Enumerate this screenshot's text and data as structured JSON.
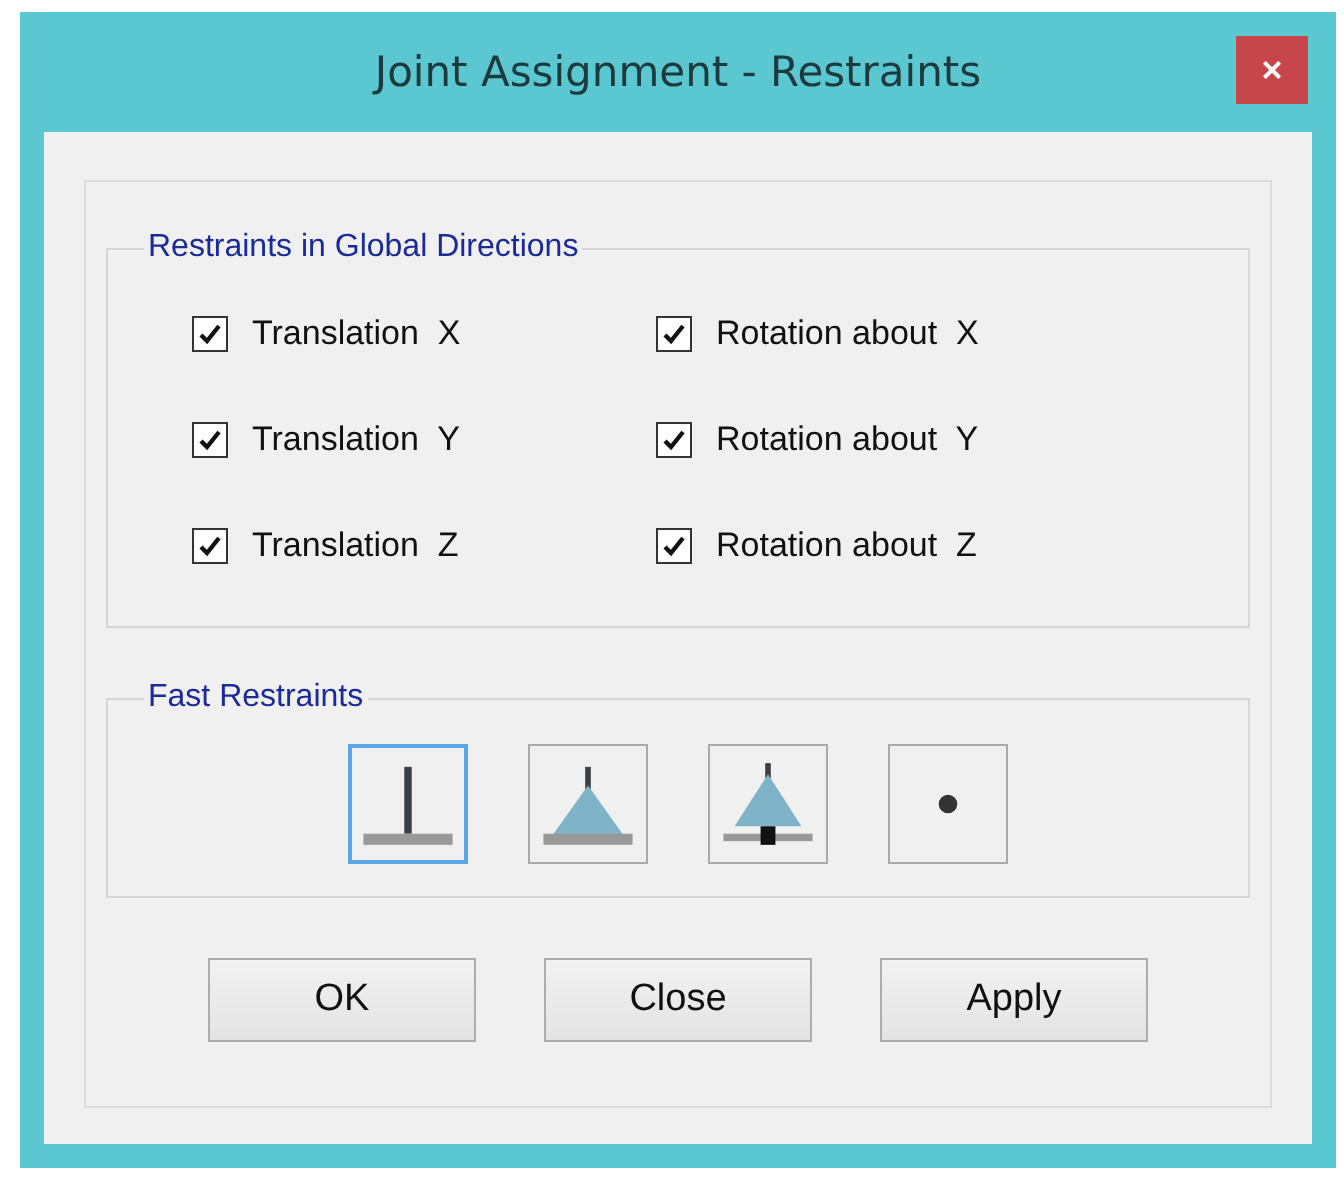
{
  "window": {
    "title": "Joint Assignment - Restraints",
    "close": "×"
  },
  "restraints": {
    "title": "Restraints in Global Directions",
    "items": [
      {
        "label": "Translation  X",
        "checked": true
      },
      {
        "label": "Rotation about  X",
        "checked": true
      },
      {
        "label": "Translation  Y",
        "checked": true
      },
      {
        "label": "Rotation about  Y",
        "checked": true
      },
      {
        "label": "Translation  Z",
        "checked": true
      },
      {
        "label": "Rotation about  Z",
        "checked": true
      }
    ]
  },
  "fast_restraints": {
    "title": "Fast Restraints",
    "buttons": [
      {
        "kind": "fixed",
        "selected": true
      },
      {
        "kind": "pinned",
        "selected": false
      },
      {
        "kind": "roller",
        "selected": false
      },
      {
        "kind": "free",
        "selected": false
      }
    ]
  },
  "buttons": [
    "OK",
    "Close",
    "Apply"
  ]
}
